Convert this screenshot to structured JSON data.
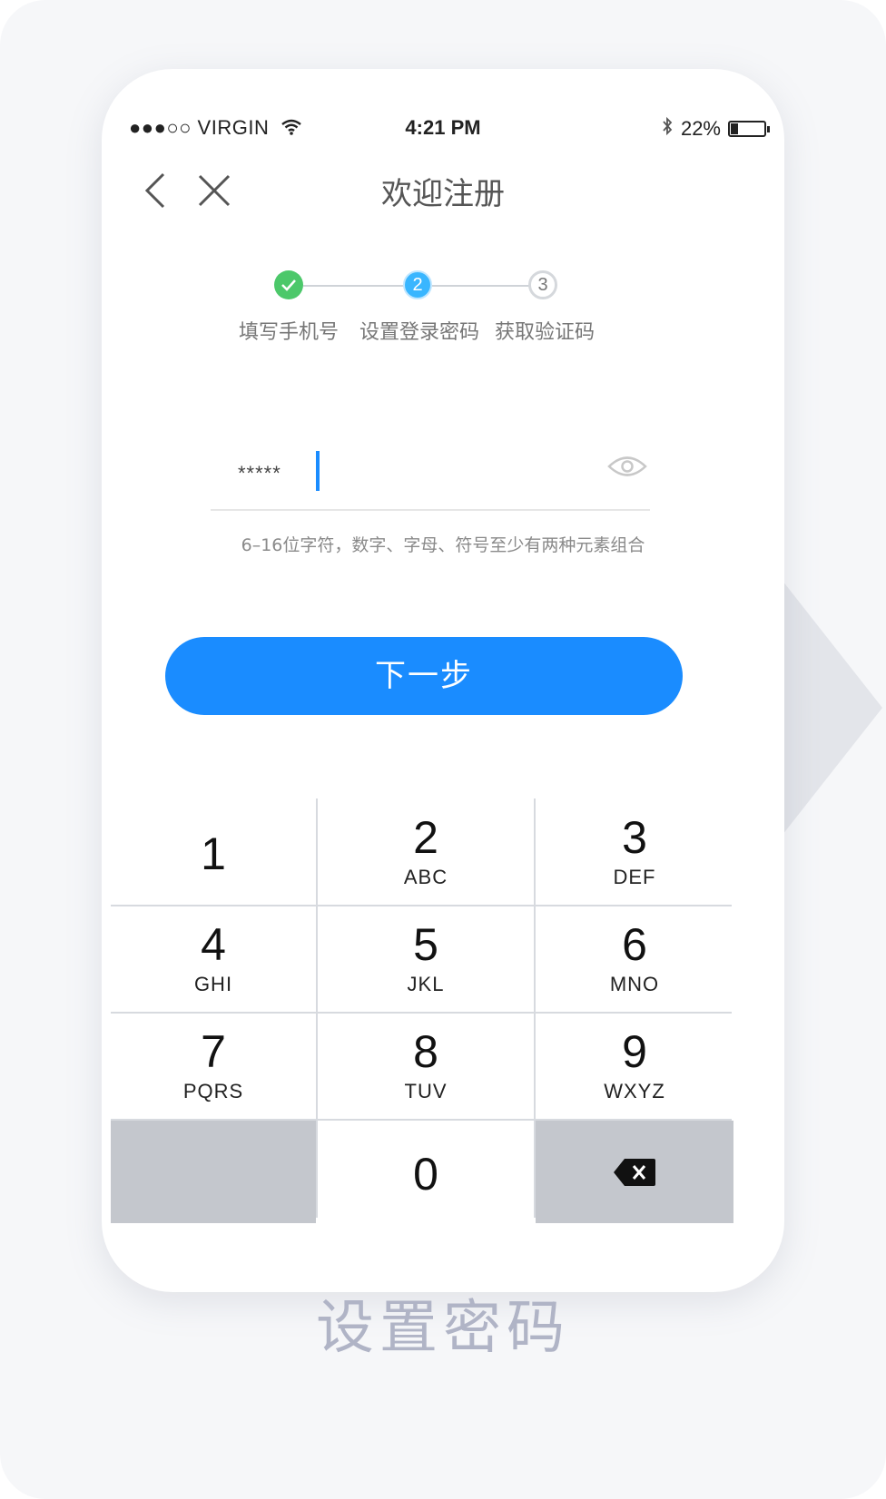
{
  "status_bar": {
    "carrier": "●●●○○ VIRGIN",
    "time": "4:21 PM",
    "battery": "22%",
    "battery_level": 0.22
  },
  "nav": {
    "title": "欢迎注册"
  },
  "steps": [
    {
      "number": "",
      "label": "填写手机号",
      "state": "done"
    },
    {
      "number": "2",
      "label": "设置登录密码",
      "state": "active"
    },
    {
      "number": "3",
      "label": "获取验证码",
      "state": "pending"
    }
  ],
  "password": {
    "masked_value": "*****"
  },
  "hint": "6–16位字符，数字、字母、符号至少有两种元素组合",
  "next_button": {
    "label": "下一步"
  },
  "keypad": [
    {
      "num": "1",
      "letters": ""
    },
    {
      "num": "2",
      "letters": "ABC"
    },
    {
      "num": "3",
      "letters": "DEF"
    },
    {
      "num": "4",
      "letters": "GHI"
    },
    {
      "num": "5",
      "letters": "JKL"
    },
    {
      "num": "6",
      "letters": "MNO"
    },
    {
      "num": "7",
      "letters": "PQRS"
    },
    {
      "num": "8",
      "letters": "TUV"
    },
    {
      "num": "9",
      "letters": "WXYZ"
    },
    {
      "num": "0",
      "letters": ""
    }
  ],
  "caption": "设置密码",
  "colors": {
    "accent": "#1a8cff",
    "done": "#4cc86a",
    "active": "#39b6ff",
    "pending": "#c9cdd2"
  }
}
